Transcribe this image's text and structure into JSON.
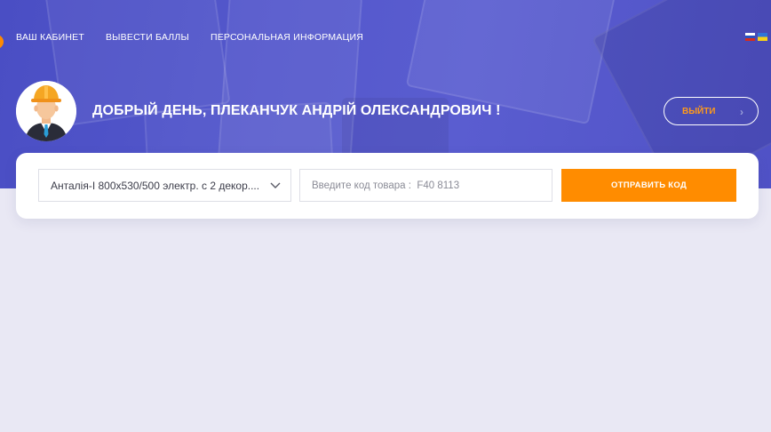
{
  "nav": {
    "items": [
      {
        "label": "ВАШ КАБИНЕТ"
      },
      {
        "label": "ВЫВЕСТИ БАЛЛЫ"
      },
      {
        "label": "ПЕРСОНАЛЬНАЯ ИНФОРМАЦИЯ"
      }
    ]
  },
  "languages": [
    {
      "icon": "flag-ru-icon"
    },
    {
      "icon": "flag-ua-icon"
    }
  ],
  "header": {
    "greeting": "ДОБРЫЙ ДЕНЬ, ПЛЕКАНЧУК АНДРІЙ ОЛЕКСАНДРОВИЧ !",
    "logout_label": "ВЫЙТИ",
    "avatar_icon": "builder-avatar-icon"
  },
  "form": {
    "product_select_value": "Анталія-I 800x530/500 электр. с 2 декор....",
    "code_placeholder": "Введите код товара :  F40 8113",
    "submit_label": "ОТПРАВИТЬ КОД"
  },
  "colors": {
    "hero": "#5458cc",
    "accent": "#ff8c00",
    "page_background": "#e9e8f4"
  }
}
